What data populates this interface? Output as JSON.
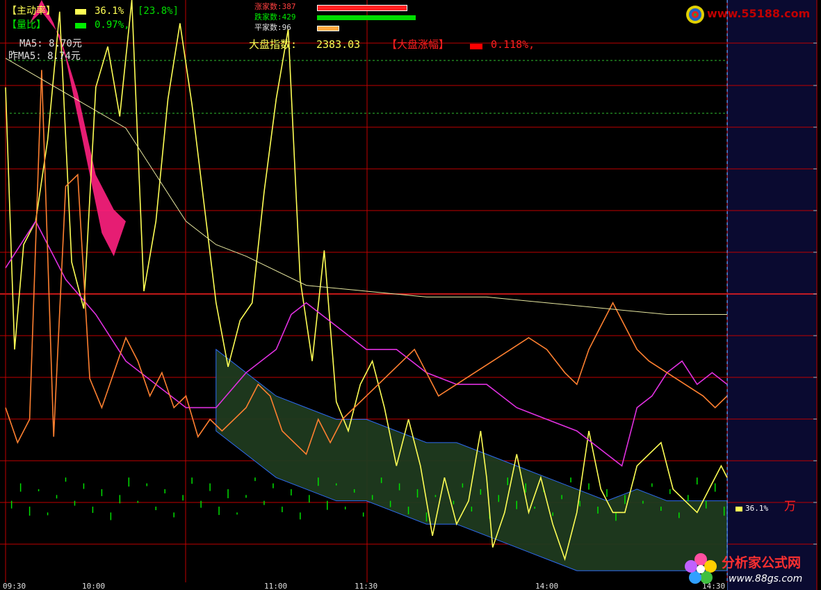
{
  "header": {
    "zhudong_label": "【主动率】",
    "zhudong_value": "36.1%",
    "zhudong_bracket": "[23.8%]",
    "liangbi_label": "【量比】",
    "liangbi_value": "0.97%,",
    "ma5_label": "MA5: 8.70元",
    "prev_ma5_label": "昨MA5: 8.74元",
    "rise_label": "涨家数:387",
    "fall_label": "跌家数:429",
    "flat_label": "平家数:96",
    "index_label": "大盘指数:",
    "index_value": "2383.03",
    "index_change_label": "【大盘涨幅】",
    "index_change_value": "0.118%,"
  },
  "right_annotation": {
    "value": "36.1%",
    "suffix": "万"
  },
  "time_axis": [
    "09:30",
    "10:00",
    "11:00",
    "11:30",
    "14:00",
    "14:30"
  ],
  "logos": {
    "top_url": "www.55188.com",
    "bottom_name": "分析家公式网",
    "bottom_url": "www.88gs.com"
  },
  "colors": {
    "background": "#000000",
    "grid": "#c00000",
    "yellow": "#ffff55",
    "magenta": "#e030e0",
    "orange": "#ff8030",
    "green": "#00e000",
    "blue": "#3070ff",
    "dark_fill": "#1f3a1f",
    "pink_fill": "#ff2080",
    "panel_right": "#0a0a30"
  },
  "chart_data": {
    "type": "line",
    "title": "",
    "xlabel": "",
    "ylabel": "",
    "xlim": [
      0,
      240
    ],
    "series": [
      {
        "color": "yellow",
        "values": [
          [
            0,
            85
          ],
          [
            3,
            40
          ],
          [
            6,
            58
          ],
          [
            10,
            62
          ],
          [
            14,
            76
          ],
          [
            18,
            98
          ],
          [
            22,
            55
          ],
          [
            26,
            47
          ],
          [
            30,
            85
          ],
          [
            34,
            92
          ],
          [
            38,
            80
          ],
          [
            42,
            100
          ],
          [
            46,
            50
          ],
          [
            50,
            62
          ],
          [
            54,
            83
          ],
          [
            58,
            96
          ],
          [
            62,
            82
          ],
          [
            66,
            65
          ],
          [
            70,
            48
          ],
          [
            74,
            37
          ],
          [
            78,
            45
          ],
          [
            82,
            48
          ],
          [
            86,
            67
          ],
          [
            90,
            83
          ],
          [
            94,
            95
          ],
          [
            98,
            52
          ],
          [
            102,
            38
          ],
          [
            106,
            57
          ],
          [
            110,
            31
          ],
          [
            114,
            26
          ],
          [
            118,
            34
          ],
          [
            122,
            38
          ],
          [
            126,
            30
          ],
          [
            130,
            20
          ],
          [
            134,
            28
          ],
          [
            138,
            20
          ],
          [
            142,
            8
          ],
          [
            146,
            18
          ],
          [
            150,
            10
          ],
          [
            154,
            14
          ],
          [
            158,
            26
          ],
          [
            160,
            18
          ],
          [
            162,
            6
          ],
          [
            166,
            12
          ],
          [
            170,
            22
          ],
          [
            174,
            12
          ],
          [
            178,
            18
          ],
          [
            182,
            10
          ],
          [
            186,
            4
          ],
          [
            190,
            12
          ],
          [
            194,
            26
          ],
          [
            198,
            16
          ],
          [
            202,
            12
          ],
          [
            206,
            12
          ],
          [
            210,
            20
          ],
          [
            214,
            22
          ],
          [
            218,
            24
          ],
          [
            222,
            16
          ],
          [
            226,
            14
          ],
          [
            230,
            12
          ],
          [
            234,
            16
          ],
          [
            238,
            20
          ],
          [
            240,
            18
          ]
        ]
      },
      {
        "color": "magenta",
        "values": [
          [
            0,
            54
          ],
          [
            10,
            62
          ],
          [
            20,
            52
          ],
          [
            30,
            46
          ],
          [
            40,
            38
          ],
          [
            50,
            34
          ],
          [
            60,
            30
          ],
          [
            70,
            30
          ],
          [
            80,
            36
          ],
          [
            90,
            40
          ],
          [
            95,
            46
          ],
          [
            100,
            48
          ],
          [
            105,
            46
          ],
          [
            110,
            44
          ],
          [
            120,
            40
          ],
          [
            130,
            40
          ],
          [
            140,
            36
          ],
          [
            150,
            34
          ],
          [
            160,
            34
          ],
          [
            170,
            30
          ],
          [
            180,
            28
          ],
          [
            190,
            26
          ],
          [
            200,
            22
          ],
          [
            205,
            20
          ],
          [
            210,
            30
          ],
          [
            215,
            32
          ],
          [
            220,
            36
          ],
          [
            225,
            38
          ],
          [
            230,
            34
          ],
          [
            235,
            36
          ],
          [
            240,
            34
          ]
        ]
      },
      {
        "color": "orange",
        "values": [
          [
            0,
            30
          ],
          [
            4,
            24
          ],
          [
            8,
            28
          ],
          [
            12,
            88
          ],
          [
            16,
            25
          ],
          [
            20,
            68
          ],
          [
            24,
            70
          ],
          [
            28,
            35
          ],
          [
            32,
            30
          ],
          [
            36,
            36
          ],
          [
            40,
            42
          ],
          [
            44,
            38
          ],
          [
            48,
            32
          ],
          [
            52,
            36
          ],
          [
            56,
            30
          ],
          [
            60,
            32
          ],
          [
            64,
            25
          ],
          [
            68,
            28
          ],
          [
            72,
            26
          ],
          [
            76,
            28
          ],
          [
            80,
            30
          ],
          [
            84,
            34
          ],
          [
            88,
            32
          ],
          [
            92,
            26
          ],
          [
            96,
            24
          ],
          [
            100,
            22
          ],
          [
            104,
            28
          ],
          [
            108,
            24
          ],
          [
            112,
            28
          ],
          [
            116,
            30
          ],
          [
            120,
            32
          ],
          [
            124,
            34
          ],
          [
            128,
            36
          ],
          [
            132,
            38
          ],
          [
            136,
            40
          ],
          [
            140,
            36
          ],
          [
            144,
            32
          ],
          [
            150,
            34
          ],
          [
            156,
            36
          ],
          [
            162,
            38
          ],
          [
            168,
            40
          ],
          [
            174,
            42
          ],
          [
            180,
            40
          ],
          [
            186,
            36
          ],
          [
            190,
            34
          ],
          [
            194,
            40
          ],
          [
            198,
            44
          ],
          [
            202,
            48
          ],
          [
            206,
            44
          ],
          [
            210,
            40
          ],
          [
            214,
            38
          ],
          [
            220,
            36
          ],
          [
            226,
            34
          ],
          [
            232,
            32
          ],
          [
            236,
            30
          ],
          [
            240,
            32
          ]
        ]
      }
    ]
  }
}
